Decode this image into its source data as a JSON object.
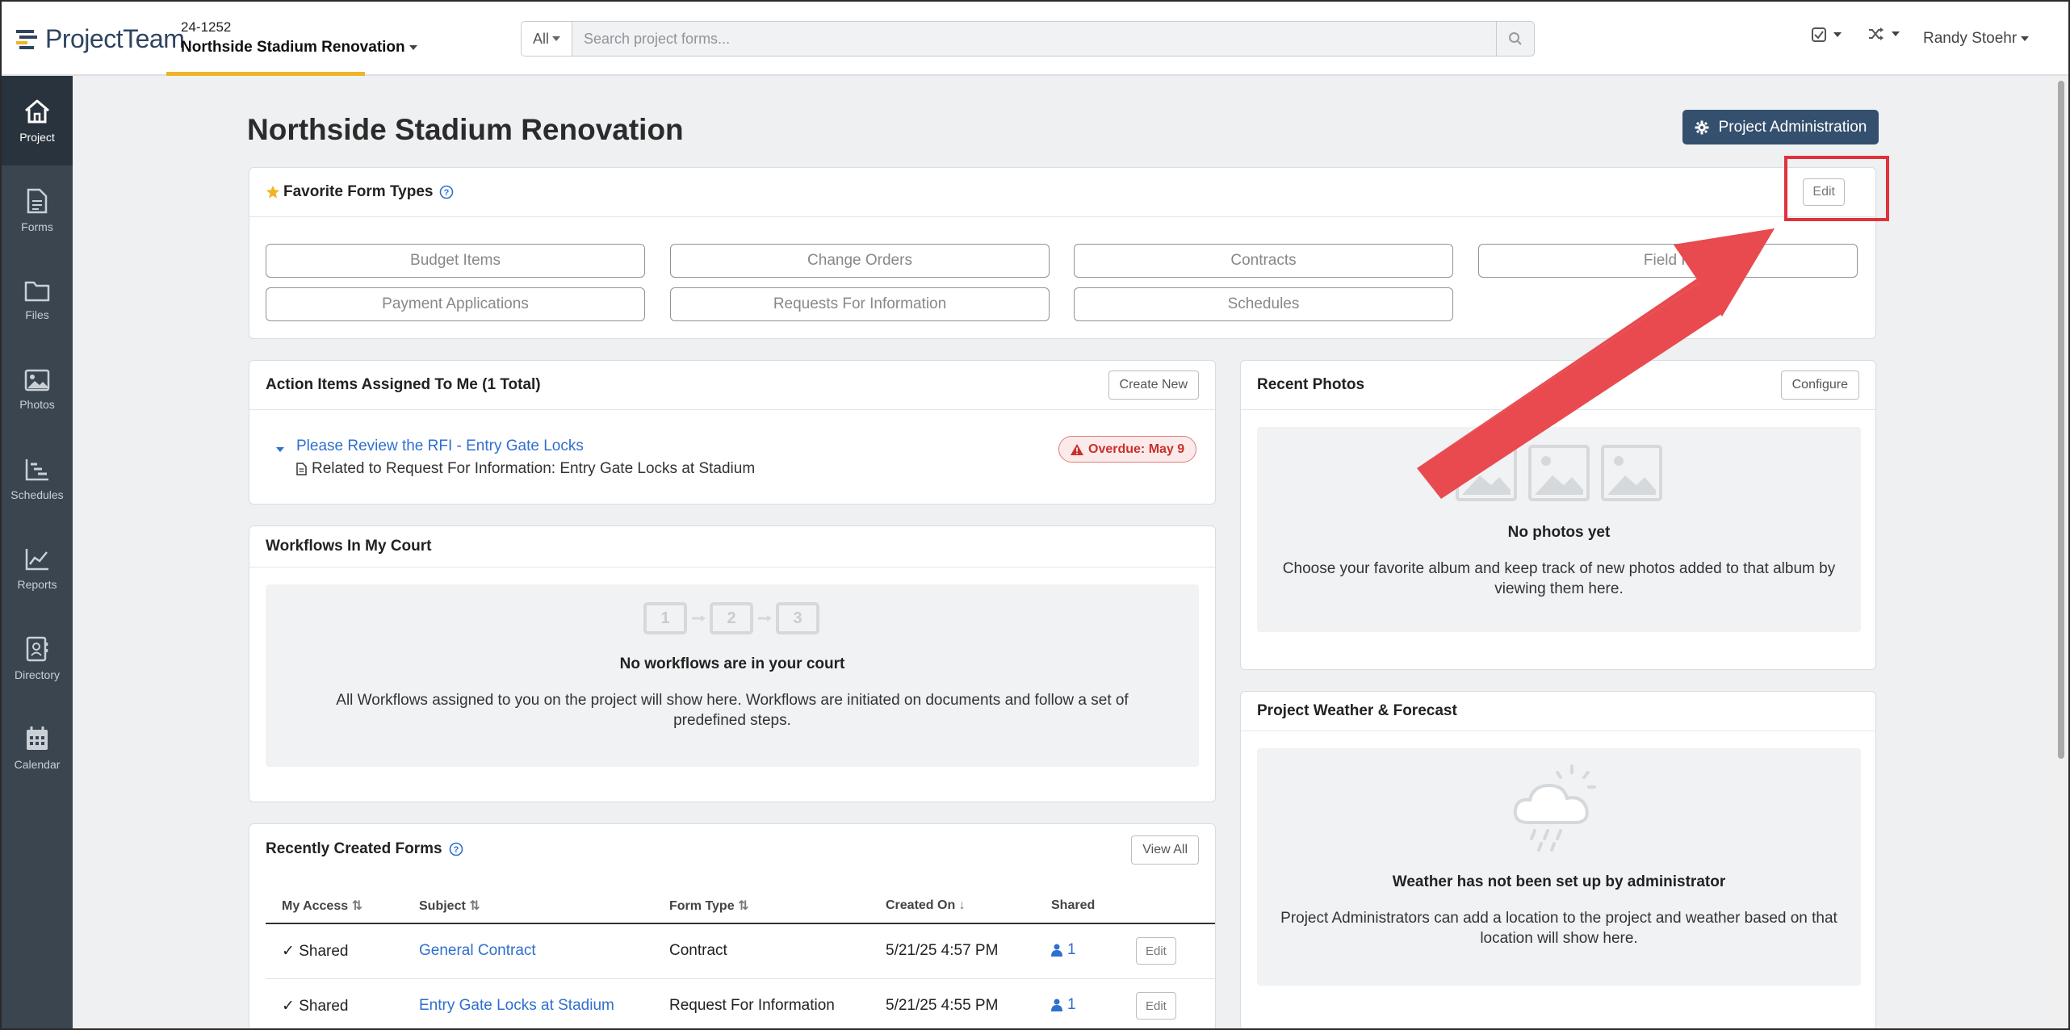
{
  "app": {
    "logo_text": "ProjectTeam",
    "project_number": "24-1252",
    "project_name": "Northside Stadium Renovation",
    "search_scope": "All",
    "search_placeholder": "Search project forms...",
    "user_name": "Randy Stoehr"
  },
  "sidebar": {
    "items": [
      {
        "label": "Project",
        "icon": "home-icon",
        "active": true
      },
      {
        "label": "Forms",
        "icon": "document-icon"
      },
      {
        "label": "Files",
        "icon": "folder-icon"
      },
      {
        "label": "Photos",
        "icon": "image-icon"
      },
      {
        "label": "Schedules",
        "icon": "gantt-icon"
      },
      {
        "label": "Reports",
        "icon": "line-chart-icon"
      },
      {
        "label": "Directory",
        "icon": "contact-card-icon"
      },
      {
        "label": "Calendar",
        "icon": "calendar-icon"
      }
    ]
  },
  "main": {
    "title": "Northside Stadium Renovation",
    "admin_button": "Project Administration"
  },
  "favorites": {
    "title": "Favorite Form Types",
    "edit_label": "Edit",
    "items": [
      "Budget Items",
      "Change Orders",
      "Contracts",
      "Field R",
      "Payment Applications",
      "Requests For Information",
      "Schedules"
    ]
  },
  "action_items": {
    "title": "Action Items Assigned To Me (1 Total)",
    "create_label": "Create New",
    "item_title": "Please Review the RFI - Entry Gate Locks",
    "item_related": "Related to Request For Information: Entry Gate Locks at Stadium",
    "overdue": "Overdue: May 9"
  },
  "workflows": {
    "title": "Workflows In My Court",
    "steps": [
      "1",
      "2",
      "3"
    ],
    "empty_title": "No workflows are in your court",
    "empty_desc": "All Workflows assigned to you on the project will show here. Workflows are initiated on documents and follow a set of predefined steps."
  },
  "photos": {
    "title": "Recent Photos",
    "configure_label": "Configure",
    "empty_title": "No photos yet",
    "empty_desc": "Choose your favorite album and keep track of new photos added to that album by viewing them here."
  },
  "weather": {
    "title": "Project Weather & Forecast",
    "empty_title": "Weather has not been set up by administrator",
    "empty_desc": "Project Administrators can add a location to the project and weather based on that location will show here."
  },
  "recent_forms": {
    "title": "Recently Created Forms",
    "view_all_label": "View All",
    "columns": [
      "My Access",
      "Subject",
      "Form Type",
      "Created On",
      "Shared"
    ],
    "rows": [
      {
        "access": "Shared",
        "subject": "General Contract",
        "form_type": "Contract",
        "created_on": "5/21/25 4:57 PM",
        "shared": "1",
        "edit": "Edit"
      },
      {
        "access": "Shared",
        "subject": "Entry Gate Locks at Stadium",
        "form_type": "Request For Information",
        "created_on": "5/21/25 4:55 PM",
        "shared": "1",
        "edit": "Edit"
      }
    ]
  },
  "colors": {
    "sidebar": "#3a4550",
    "accent_tab": "#f0b429",
    "admin_button": "#34506e",
    "link": "#2f6fcf",
    "annotation": "#e0323a"
  }
}
